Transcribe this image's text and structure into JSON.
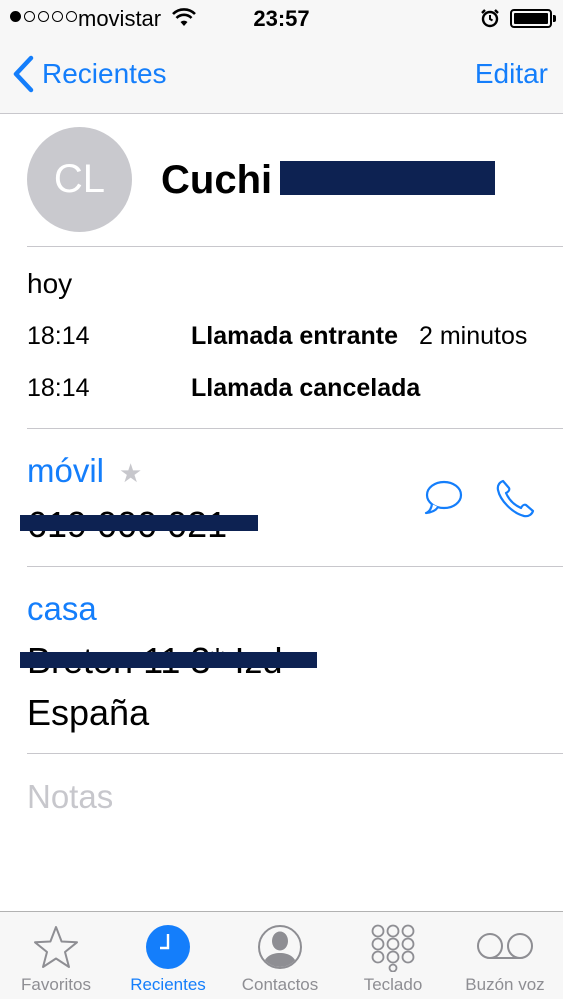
{
  "status_bar": {
    "carrier": "movistar",
    "time": "23:57",
    "signal_bars_filled": 1,
    "signal_bars_total": 5,
    "battery_level": 1.0
  },
  "nav": {
    "back_label": "Recientes",
    "edit_label": "Editar"
  },
  "contact": {
    "initials": "CL",
    "first_name": "Cuchi"
  },
  "calls": {
    "day": "hoy",
    "entries": [
      {
        "time": "18:14",
        "type": "Llamada entrante",
        "duration": "2 minutos"
      },
      {
        "time": "18:14",
        "type": "Llamada cancelada",
        "duration": ""
      }
    ]
  },
  "phone": {
    "label": "móvil",
    "number": "619 000 021"
  },
  "address": {
    "label": "casa",
    "street": "Breton 11 3* Izd",
    "country": "España"
  },
  "notes": {
    "placeholder": "Notas"
  },
  "tabbar": {
    "active": "recientes",
    "tabs": [
      {
        "id": "favoritos",
        "label": "Favoritos",
        "icon": "star-icon"
      },
      {
        "id": "recientes",
        "label": "Recientes",
        "icon": "clock-icon"
      },
      {
        "id": "contactos",
        "label": "Contactos",
        "icon": "person-icon"
      },
      {
        "id": "teclado",
        "label": "Teclado",
        "icon": "keypad-icon"
      },
      {
        "id": "buzon",
        "label": "Buzón voz",
        "icon": "voicemail-icon"
      }
    ]
  },
  "colors": {
    "accent": "#147efb",
    "redaction": "#0d2252",
    "separator": "#c8c7cc",
    "placeholder": "#c7c7cc"
  }
}
